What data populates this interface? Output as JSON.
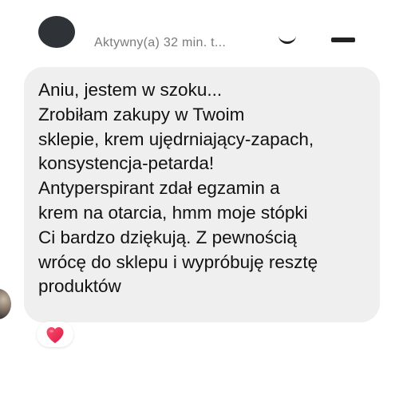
{
  "header": {
    "status": "Aktywny(a) 32 min. t..."
  },
  "message": {
    "lines": [
      "Aniu, jestem w szoku...",
      "Zrobiłam zakupy w Twoim",
      "sklepie, krem ujędrniający-zapach,",
      "konsystencja-petarda!",
      "Antyperspirant zdał egzamin a",
      "krem na otarcia, hmm moje stópki",
      "Ci bardzo dziękują. Z pewnością",
      "wrócę do sklepu i wypróbuję resztę",
      "produktów"
    ],
    "bubble_color": "#efefef",
    "text_color": "#111111"
  },
  "reaction": {
    "icon": "heart-icon",
    "color": "#e8264f"
  }
}
